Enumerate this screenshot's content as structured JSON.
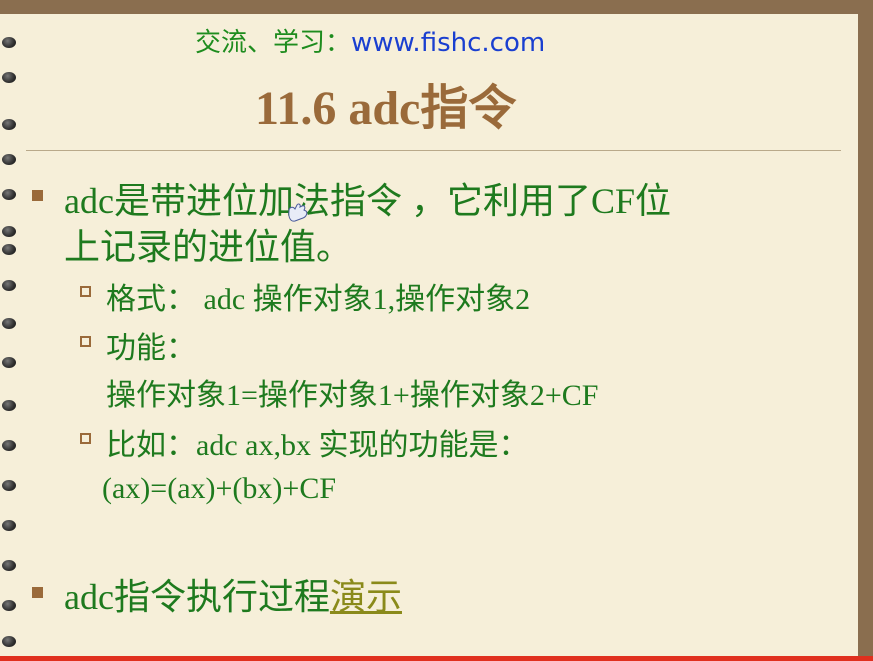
{
  "header": {
    "prefix": "交流、学习：",
    "url": "www.fishc.com"
  },
  "title": "11.6 adc指令",
  "bullets": {
    "b1_line1": "adc是带进位加法指令 ，它利用了CF位",
    "b1_line2": "上记录的进位值。",
    "format": "格式：  adc 操作对象1,操作对象2",
    "function_label": "功能：",
    "function_formula": "操作对象1=操作对象1+操作对象2+CF",
    "example_label": "比如：adc ax,bx 实现的功能是：",
    "example_formula": "(ax)=(ax)+(bx)+CF",
    "b2_text": "adc指令执行过程",
    "b2_link": "演示"
  },
  "colors": {
    "text_green": "#1e7a1e",
    "title_brown": "#9a6a3a",
    "link_blue": "#1a3fd0",
    "paper": "#f6efd9"
  }
}
